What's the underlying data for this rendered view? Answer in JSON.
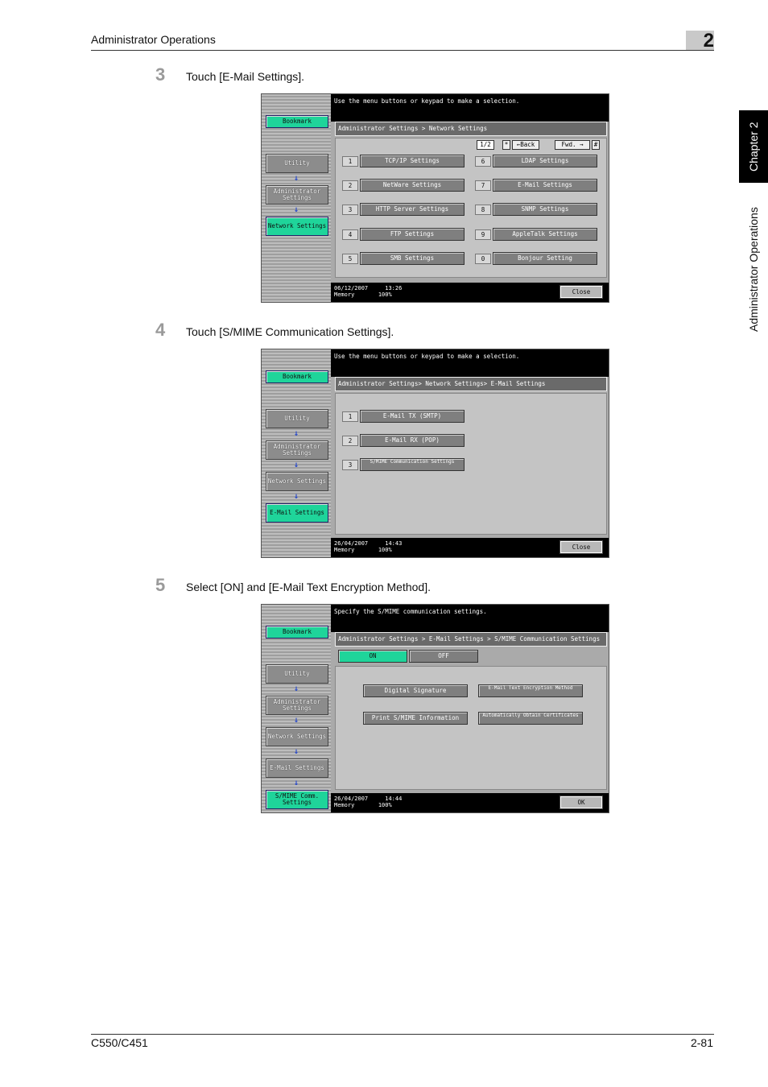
{
  "header": {
    "title": "Administrator Operations",
    "chapter_number": "2"
  },
  "side_tab": {
    "chapter": "Chapter 2",
    "section": "Administrator Operations"
  },
  "footer": {
    "model": "C550/C451",
    "page": "2-81"
  },
  "steps": [
    {
      "number": "3",
      "text": "Touch [E-Mail Settings]."
    },
    {
      "number": "4",
      "text": "Touch [S/MIME Communication Settings]."
    },
    {
      "number": "5",
      "text": "Select [ON] and [E-Mail Text Encryption Method]."
    }
  ],
  "screen1": {
    "bookmark": "Bookmark",
    "nav": [
      "Utility",
      "Administrator Settings",
      "Network Settings"
    ],
    "message": "Use the menu buttons or keypad to make a selection.",
    "breadcrumb": "Administrator Settings > Network Settings",
    "page_indicator": "1/2",
    "back_label": "←Back",
    "forward_label": "Fwd.",
    "left_items": [
      {
        "num": "1",
        "label": "TCP/IP Settings"
      },
      {
        "num": "2",
        "label": "NetWare Settings"
      },
      {
        "num": "3",
        "label": "HTTP Server Settings"
      },
      {
        "num": "4",
        "label": "FTP Settings"
      },
      {
        "num": "5",
        "label": "SMB Settings"
      }
    ],
    "right_items": [
      {
        "num": "6",
        "label": "LDAP Settings"
      },
      {
        "num": "7",
        "label": "E-Mail Settings"
      },
      {
        "num": "8",
        "label": "SNMP Settings"
      },
      {
        "num": "9",
        "label": "AppleTalk Settings"
      },
      {
        "num": "0",
        "label": "Bonjour Setting"
      }
    ],
    "date": "06/12/2007",
    "time": "13:26",
    "memory_label": "Memory",
    "memory_value": "100%",
    "close": "Close"
  },
  "screen2": {
    "bookmark": "Bookmark",
    "nav": [
      "Utility",
      "Administrator Settings",
      "Network Settings",
      "E-Mail Settings"
    ],
    "message": "Use the menu buttons or keypad to make a selection.",
    "breadcrumb": "Administrator Settings> Network Settings> E-Mail Settings",
    "items": [
      {
        "num": "1",
        "label": "E-Mail TX (SMTP)"
      },
      {
        "num": "2",
        "label": "E-Mail RX (POP)"
      },
      {
        "num": "3",
        "label": "S/MIME Communication Settings"
      }
    ],
    "date": "26/04/2007",
    "time": "14:43",
    "memory_label": "Memory",
    "memory_value": "100%",
    "close": "Close"
  },
  "screen3": {
    "bookmark": "Bookmark",
    "nav": [
      "Utility",
      "Administrator Settings",
      "Network Settings",
      "E-Mail Settings",
      "S/MIME Comm. Settings"
    ],
    "message": "Specify the S/MIME communication settings.",
    "breadcrumb": "Administrator Settings > E-Mail Settings > S/MIME Communication Settings",
    "on": "ON",
    "off": "OFF",
    "buttons": [
      "Digital Signature",
      "E-Mail Text Encryption Method",
      "Print S/MIME Information",
      "Automatically Obtain Certificates"
    ],
    "date": "26/04/2007",
    "time": "14:44",
    "memory_label": "Memory",
    "memory_value": "100%",
    "ok": "OK"
  },
  "colors": {
    "accent_green": "#1fd49a",
    "arrow_blue": "#2244cc"
  }
}
